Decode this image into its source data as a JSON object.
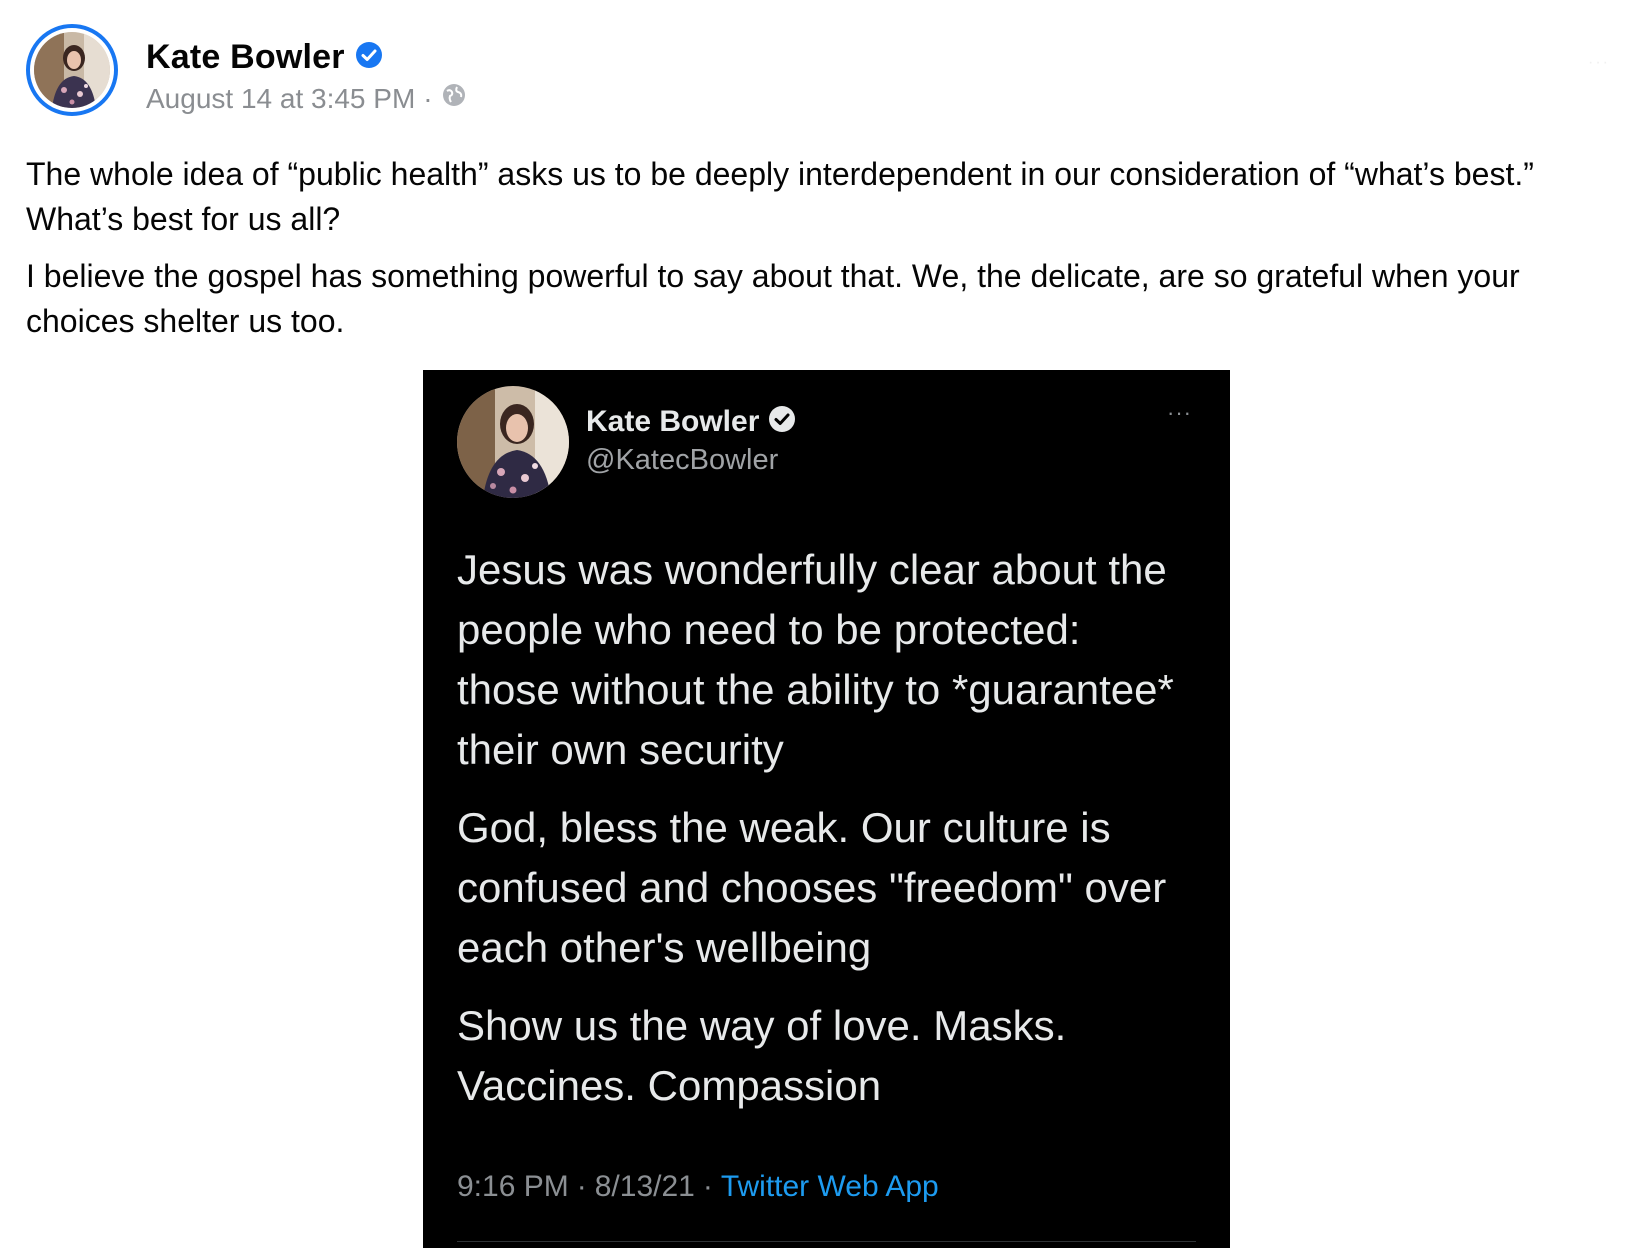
{
  "post": {
    "author": {
      "name": "Kate Bowler",
      "verified_icon": "verified-badge-icon"
    },
    "meta": {
      "timestamp": "August 14 at 3:45 PM",
      "separator": "·",
      "audience_icon": "globe-icon"
    },
    "menu_label": "···",
    "paragraphs": [
      "The whole idea of “public health” asks us to be deeply interdependent in our consideration of “what’s best.” What’s best for us all?",
      "I believe the gospel has something powerful to say about that. We, the delicate, are so grateful when your choices shelter us too."
    ]
  },
  "tweet": {
    "name": "Kate Bowler",
    "handle": "@KatecBowler",
    "more_label": "···",
    "paragraphs": [
      "Jesus was wonderfully clear about the people who need to be protected: those without the ability to *guarantee* their own security",
      "God, bless the weak. Our culture is confused and chooses \"freedom\" over each other's wellbeing",
      "Show us the way of love. Masks. Vaccines. Compassion"
    ],
    "time": "9:16 PM",
    "separator": "·",
    "date": "8/13/21",
    "source": "Twitter Web App"
  },
  "colors": {
    "facebook_blue": "#1877f2",
    "twitter_blue": "#1d9bf0",
    "tweet_background": "#000000",
    "meta_gray": "#8a8d91"
  }
}
